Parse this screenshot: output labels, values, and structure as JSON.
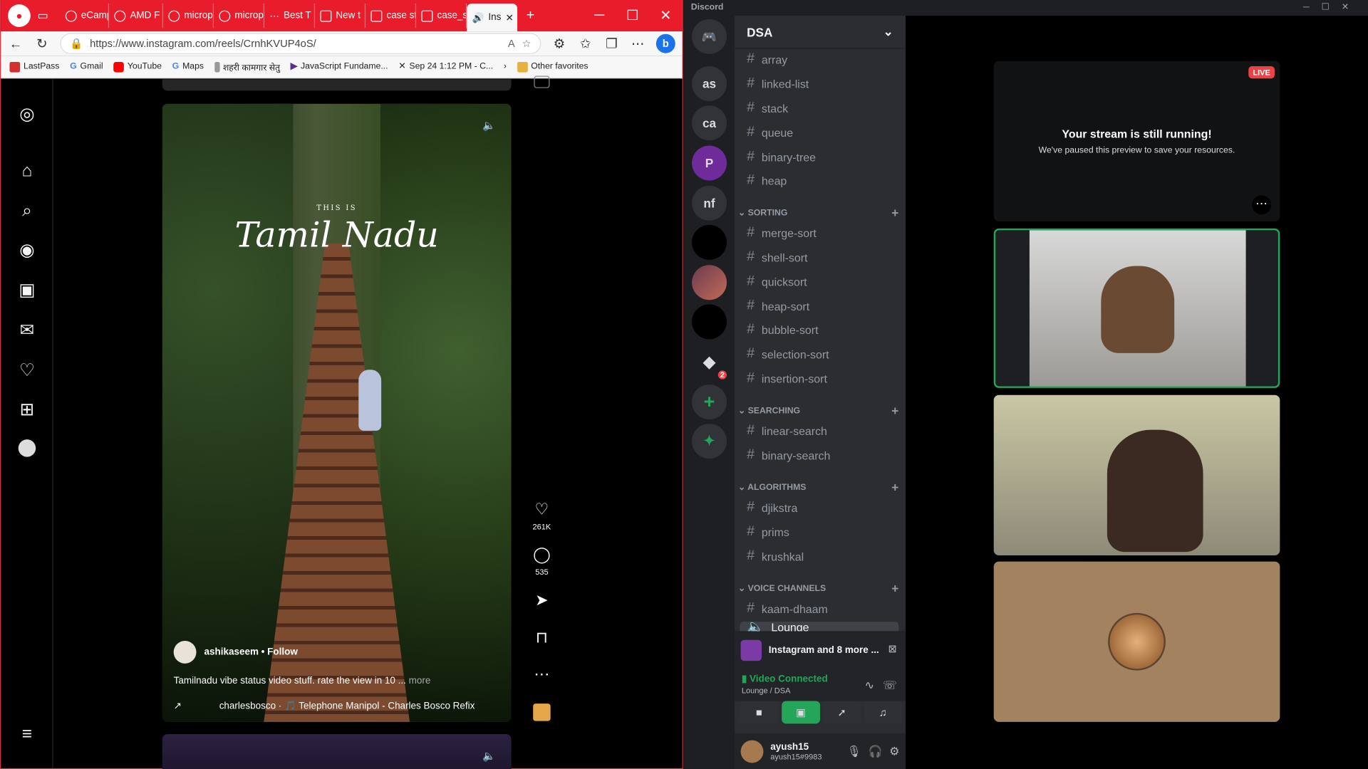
{
  "browser": {
    "tabs": [
      "eCamp",
      "AMD F",
      "microp",
      "microp",
      "Best T",
      "New t",
      "case st",
      "case_s",
      "Ins"
    ],
    "url": "https://www.instagram.com/reels/CrnhKVUP4oS/",
    "bookmarks": [
      "LastPass",
      "Gmail",
      "YouTube",
      "Maps",
      "शहरी कामगार सेतु",
      "JavaScript Fundame...",
      "Sep 24 1:12 PM - C..."
    ],
    "other_favorites": "Other favorites",
    "colors": {
      "tab_bar": "#e81c2b"
    }
  },
  "instagram": {
    "video_title_small": "THIS IS",
    "video_title_big": "Tamil Nadu",
    "username": "ashikaseem",
    "separator": "•",
    "follow_label": "Follow",
    "caption": "Tamilnadu vibe status video stuff. rate the view in 10 ...",
    "more_label": "more",
    "audio": "charlesbosco · 🎵 Telephone Manipol - Charles Bosco Refix",
    "likes": "261K",
    "comments": "535"
  },
  "discord": {
    "app_title": "Discord",
    "server_name": "DSA",
    "servers": [
      "as",
      "ca",
      "nf"
    ],
    "server_badge": "2",
    "top_channels": [
      "array",
      "linked-list",
      "stack",
      "queue",
      "binary-tree",
      "heap"
    ],
    "categories": {
      "sorting": {
        "name": "SORTING",
        "channels": [
          "merge-sort",
          "shell-sort",
          "quicksort",
          "heap-sort",
          "bubble-sort",
          "selection-sort",
          "insertion-sort"
        ]
      },
      "searching": {
        "name": "SEARCHING",
        "channels": [
          "linear-search",
          "binary-search"
        ]
      },
      "algorithms": {
        "name": "ALGORITHMS",
        "channels": [
          "djikstra",
          "prims",
          "krushkal"
        ]
      },
      "voice": {
        "name": "VOICE CHANNELS",
        "channels": [
          "kaam-dhaam",
          "Lounge"
        ]
      }
    },
    "activity": "Instagram and 8 more ...",
    "voice_status": "Video Connected",
    "voice_location": "Lounge / DSA",
    "username": "ayush15",
    "tag": "ayush15#9983",
    "live_label": "LIVE",
    "stream_title": "Your stream is still running!",
    "stream_sub": "We've paused this preview to save your resources.",
    "colors": {
      "accent": "#23a55a",
      "live": "#ed4245"
    }
  }
}
